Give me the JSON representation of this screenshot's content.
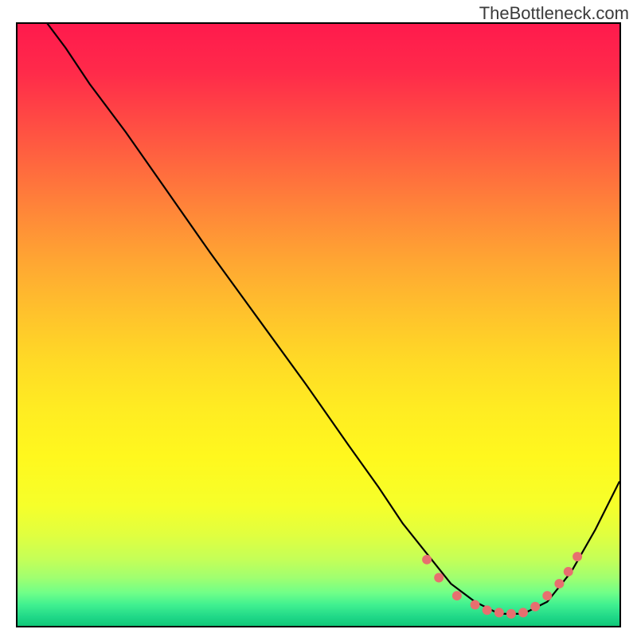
{
  "watermark": "TheBottleneck.com",
  "chart_data": {
    "type": "line",
    "title": "",
    "xlabel": "",
    "ylabel": "",
    "xlim": [
      0,
      100
    ],
    "ylim": [
      0,
      100
    ],
    "grid": false,
    "series": [
      {
        "name": "curve",
        "color": "#000000",
        "x": [
          0,
          2,
          5,
          8,
          12,
          18,
          25,
          32,
          40,
          48,
          55,
          60,
          64,
          68,
          72,
          76,
          80,
          84,
          88,
          92,
          96,
          100
        ],
        "y": [
          108,
          104,
          100,
          96,
          90,
          82,
          72,
          62,
          51,
          40,
          30,
          23,
          17,
          12,
          7,
          4,
          2,
          2,
          4,
          9,
          16,
          24
        ]
      }
    ],
    "markers": {
      "name": "fit-dots",
      "color": "#e76f6f",
      "radius": 6,
      "points": [
        {
          "x": 68,
          "y": 11
        },
        {
          "x": 70,
          "y": 8
        },
        {
          "x": 73,
          "y": 5
        },
        {
          "x": 76,
          "y": 3.5
        },
        {
          "x": 78,
          "y": 2.6
        },
        {
          "x": 80,
          "y": 2.2
        },
        {
          "x": 82,
          "y": 2.0
        },
        {
          "x": 84,
          "y": 2.2
        },
        {
          "x": 86,
          "y": 3.2
        },
        {
          "x": 88,
          "y": 5
        },
        {
          "x": 90,
          "y": 7
        },
        {
          "x": 91.5,
          "y": 9
        },
        {
          "x": 93,
          "y": 11.5
        }
      ]
    },
    "gradient_bands": [
      {
        "stop": 0.0,
        "color": "#ff1a4d"
      },
      {
        "stop": 0.08,
        "color": "#ff2a4a"
      },
      {
        "stop": 0.16,
        "color": "#ff4a44"
      },
      {
        "stop": 0.24,
        "color": "#ff6a3e"
      },
      {
        "stop": 0.32,
        "color": "#ff8a38"
      },
      {
        "stop": 0.4,
        "color": "#ffa832"
      },
      {
        "stop": 0.48,
        "color": "#ffc22c"
      },
      {
        "stop": 0.56,
        "color": "#ffda26"
      },
      {
        "stop": 0.64,
        "color": "#ffec22"
      },
      {
        "stop": 0.72,
        "color": "#fff81e"
      },
      {
        "stop": 0.8,
        "color": "#f6ff2a"
      },
      {
        "stop": 0.85,
        "color": "#e0ff40"
      },
      {
        "stop": 0.89,
        "color": "#c4ff58"
      },
      {
        "stop": 0.92,
        "color": "#a0ff70"
      },
      {
        "stop": 0.945,
        "color": "#70ff88"
      },
      {
        "stop": 0.965,
        "color": "#40f090"
      },
      {
        "stop": 0.985,
        "color": "#20d888"
      },
      {
        "stop": 1.0,
        "color": "#10c878"
      }
    ]
  }
}
